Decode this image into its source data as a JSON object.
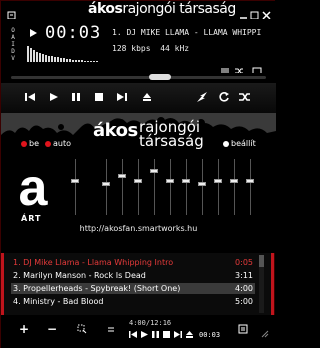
{
  "title_bar": {
    "brand_bold": "ákos",
    "brand_rest": "rajongói társaság",
    "buttons": [
      "menu-icon",
      "minimize-icon",
      "shade-icon",
      "close-icon"
    ]
  },
  "display": {
    "vis_label": "OAIDV",
    "play_state_icon": "play-icon",
    "time": "00:03",
    "track_marquee": "1. DJ MIKE LLAMA - LLAMA WHIPPI",
    "kbps": "128",
    "kbps_unit": "kbps",
    "khz": "44",
    "khz_unit": "kHz",
    "side_buttons": [
      "playlist-toggle-icon",
      "shuffle-icon",
      "repeat-icon"
    ]
  },
  "seek": {
    "position_fraction": 0.56
  },
  "transport": {
    "buttons": [
      "previous-icon",
      "play-icon",
      "pause-icon",
      "stop-icon",
      "next-icon",
      "eject-icon",
      "winamp-bolt-icon",
      "repeat-icon",
      "shuffle-icon"
    ]
  },
  "banner": {
    "logo_bold": "ákos",
    "logo_line1": "rajongói",
    "logo_line2": "társaság"
  },
  "equalizer": {
    "on_label": "be",
    "auto_label": "auto",
    "presets_label": "beállít",
    "preamp_level": 0.62,
    "band_levels": [
      0.55,
      0.72,
      0.62,
      0.8,
      0.62,
      0.62,
      0.55,
      0.62,
      0.62,
      0.62
    ],
    "colors": {
      "led": "#e0141c",
      "accent": "#c0141c"
    }
  },
  "art_logo": {
    "text": "ÁRT"
  },
  "url": "http://akosfan.smartworks.hu",
  "playlist": {
    "items": [
      {
        "title": "1. DJ Mike Llama - Llama Whipping Intro",
        "duration": "0:05",
        "current": true,
        "selected": false
      },
      {
        "title": "2. Marilyn Manson - Rock Is Dead",
        "duration": "3:11",
        "current": false,
        "selected": false
      },
      {
        "title": "3. Propellerheads - Spybreak! (Short One)",
        "duration": "4:00",
        "current": false,
        "selected": true
      },
      {
        "title": "4. Ministry - Bad Blood",
        "duration": "5:00",
        "current": false,
        "selected": false
      }
    ],
    "colors": {
      "current": "#e63a3a",
      "selected_bg": "#3a3a3a"
    }
  },
  "bottom": {
    "add": "+",
    "remove": "−",
    "total_time": "4:00/12:16",
    "mini_time": "00:03"
  }
}
